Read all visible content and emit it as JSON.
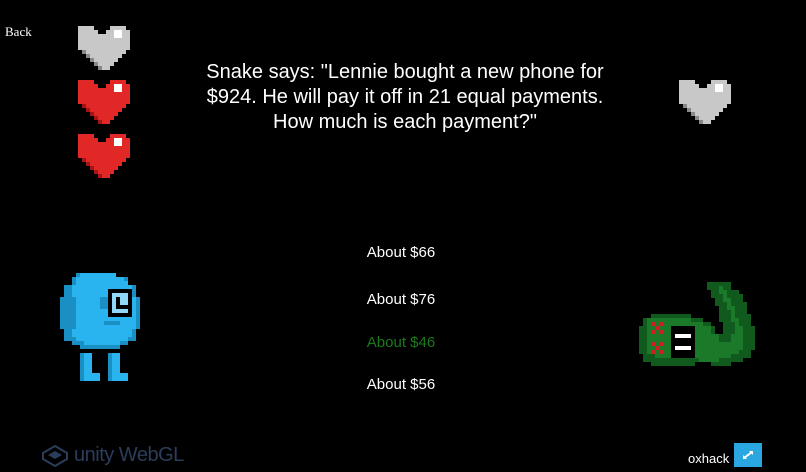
{
  "back_label": "Back",
  "question": "Snake says: \"Lennie bought a new phone for $924. He will pay it off in 21 equal payments. How much is each payment?\"",
  "answers": [
    {
      "label": "About $66",
      "color": "#ffffff"
    },
    {
      "label": "About $76",
      "color": "#ffffff"
    },
    {
      "label": "About $46",
      "color": "#1a7a1a"
    },
    {
      "label": "About $56",
      "color": "#ffffff"
    }
  ],
  "player_hearts": [
    {
      "state": "empty",
      "icon": "heart-icon"
    },
    {
      "state": "full",
      "icon": "heart-icon"
    },
    {
      "state": "full",
      "icon": "heart-icon"
    }
  ],
  "enemy_hearts": [
    {
      "state": "empty",
      "icon": "heart-icon"
    }
  ],
  "colors": {
    "heart_full": "#e22727",
    "heart_empty": "#c8c8c8",
    "player": "#29b4f0",
    "snake": "#0f5a1c",
    "fullscreen": "#2aa6e0"
  },
  "footer": {
    "engine_logo": "unity WebGL",
    "author": "oxhack"
  }
}
